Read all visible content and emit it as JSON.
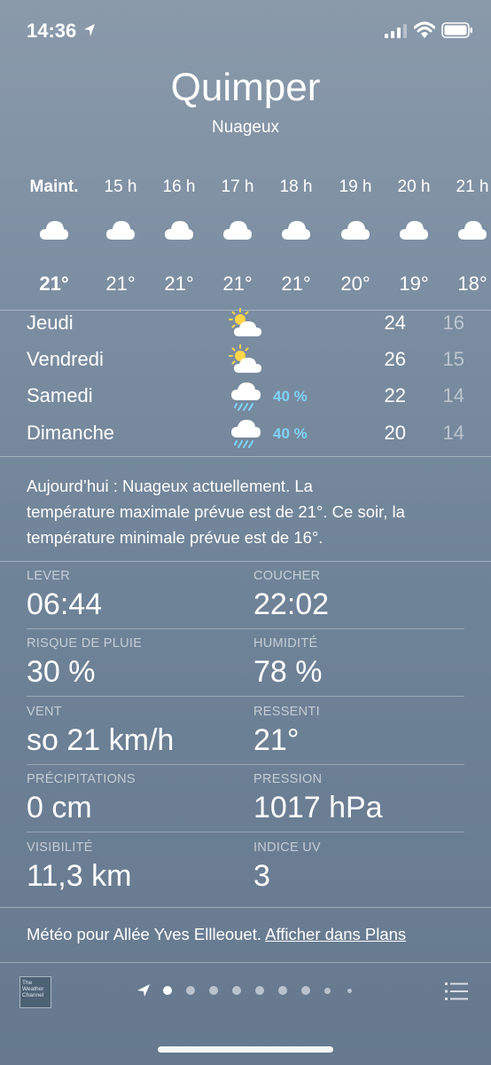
{
  "status_bar": {
    "time": "14:36"
  },
  "header": {
    "city": "Quimper",
    "condition": "Nuageux"
  },
  "hourly": [
    {
      "label": "Maint.",
      "temp": "21°",
      "icon": "cloud-icon",
      "now": true
    },
    {
      "label": "15 h",
      "temp": "21°",
      "icon": "cloud-icon"
    },
    {
      "label": "16 h",
      "temp": "21°",
      "icon": "cloud-icon"
    },
    {
      "label": "17 h",
      "temp": "21°",
      "icon": "cloud-icon"
    },
    {
      "label": "18 h",
      "temp": "21°",
      "icon": "cloud-icon"
    },
    {
      "label": "19 h",
      "temp": "20°",
      "icon": "cloud-icon"
    },
    {
      "label": "20 h",
      "temp": "19°",
      "icon": "cloud-icon"
    },
    {
      "label": "21 h",
      "temp": "18°",
      "icon": "cloud-icon"
    }
  ],
  "daily": [
    {
      "day": "Jeudi",
      "icon": "partly-sunny-icon",
      "chance": "",
      "high": "24",
      "low": "16"
    },
    {
      "day": "Vendredi",
      "icon": "partly-sunny-icon",
      "chance": "",
      "high": "26",
      "low": "15"
    },
    {
      "day": "Samedi",
      "icon": "rain-cloud-icon",
      "chance": "40 %",
      "high": "22",
      "low": "14"
    },
    {
      "day": "Dimanche",
      "icon": "rain-cloud-icon",
      "chance": "40 %",
      "high": "20",
      "low": "14"
    }
  ],
  "summary": {
    "line1": "Aujourd’hui : Nuageux actuellement. La",
    "line2": "température maximale prévue est de 21°. Ce soir, la",
    "line3": "température minimale prévue est de 16°."
  },
  "details": [
    {
      "label": "LEVER",
      "value": "06:44"
    },
    {
      "label": "COUCHER",
      "value": "22:02"
    },
    {
      "label": "RISQUE DE PLUIE",
      "value": "30 %"
    },
    {
      "label": "HUMIDITÉ",
      "value": "78 %"
    },
    {
      "label": "VENT",
      "value": "so 21 km/h"
    },
    {
      "label": "RESSENTI",
      "value": "21°"
    },
    {
      "label": "PRÉCIPITATIONS",
      "value": "0 cm"
    },
    {
      "label": "PRESSION",
      "value": "1017 hPa"
    },
    {
      "label": "VISIBILITÉ",
      "value": "11,3 km"
    },
    {
      "label": "INDICE UV",
      "value": "3"
    }
  ],
  "footer": {
    "text": "Météo pour Allée Yves Ellleouet.",
    "link": "Afficher dans Plans"
  },
  "logo": {
    "line1": "The",
    "line2": "Weather",
    "line3": "Channel"
  },
  "pager": {
    "page_count": 9,
    "current_page": 0
  },
  "colors": {
    "precip_chance": "#7fd3f7",
    "background_top": "#8a9aab",
    "background_bottom": "#66798f"
  }
}
